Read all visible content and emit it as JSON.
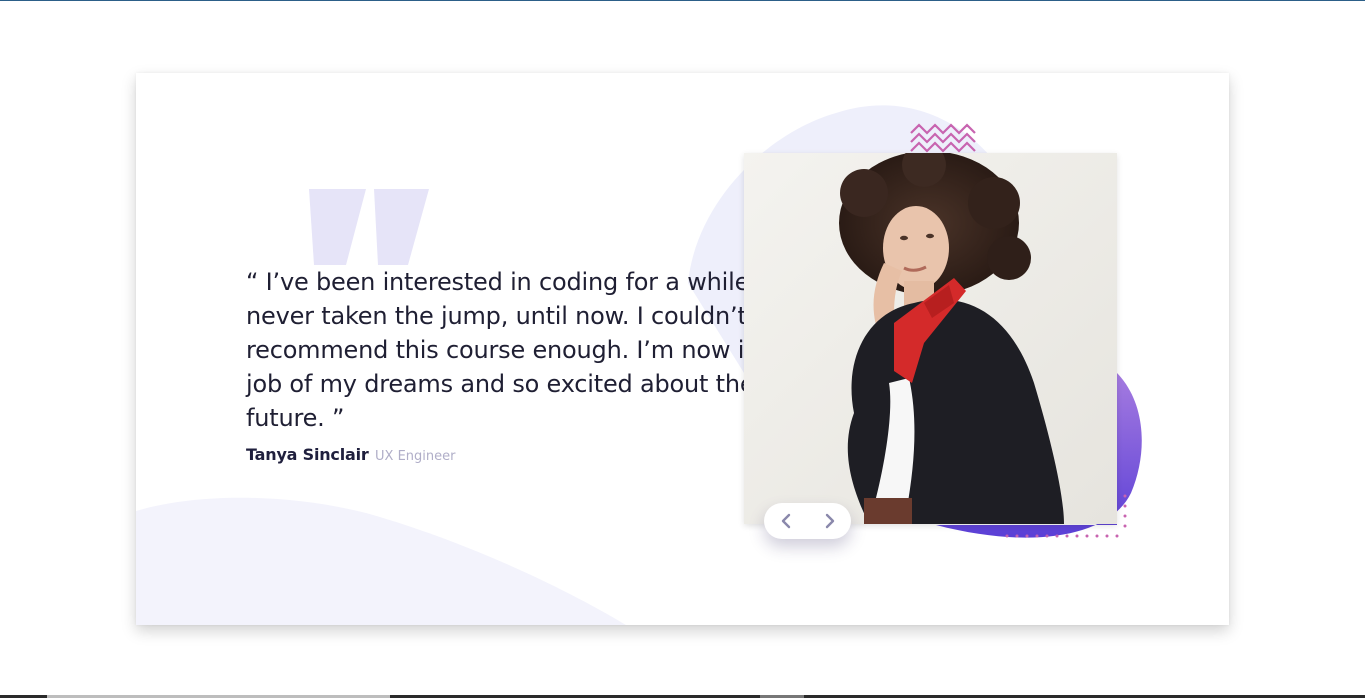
{
  "testimonial": {
    "quote": "“ I’ve been interested in coding for a while but never taken the jump, until now. I couldn’t recommend this course enough. I’m now in the job of my dreams and so excited about the future. ”",
    "author_name": "Tanya Sinclair",
    "author_role": "UX Engineer"
  },
  "photo": {
    "subject": "woman-with-curly-hair-red-scarf-black-coat"
  },
  "controls": {
    "prev_icon": "chevron-left-icon",
    "next_icon": "chevron-right-icon"
  },
  "colors": {
    "text_dark": "#1f1f3d",
    "text_muted": "#b0aec8",
    "accent_purple": "#6544d6",
    "accent_pink": "#c864b0",
    "bg_lavender": "#eef0fb",
    "quote_mark": "#e6e4f8"
  }
}
